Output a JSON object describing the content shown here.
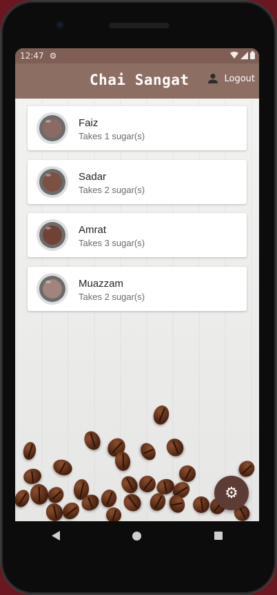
{
  "status": {
    "time": "12:47",
    "settings_icon": "gear-icon",
    "right_icons": [
      "wifi-icon",
      "signal-icon",
      "battery-icon"
    ]
  },
  "appbar": {
    "title": "Chai Sangat",
    "logout_label": "Logout",
    "logout_icon": "person-icon"
  },
  "people": [
    {
      "name": "Faiz",
      "detail": "Takes 1 sugar(s)",
      "tea_color": "#8a6a62"
    },
    {
      "name": "Sadar",
      "detail": "Takes 2 sugar(s)",
      "tea_color": "#7d5044"
    },
    {
      "name": "Amrat",
      "detail": "Takes 3 sugar(s)",
      "tea_color": "#704235"
    },
    {
      "name": "Muazzam",
      "detail": "Takes 2 sugar(s)",
      "tea_color": "#a1847c"
    }
  ],
  "fab": {
    "icon": "gear-icon"
  },
  "colors": {
    "appbar": "#8d6e63",
    "statusbar": "#7f5e55",
    "fab": "#5d3c35"
  },
  "navigation": [
    "back-icon",
    "home-icon",
    "recents-icon"
  ]
}
